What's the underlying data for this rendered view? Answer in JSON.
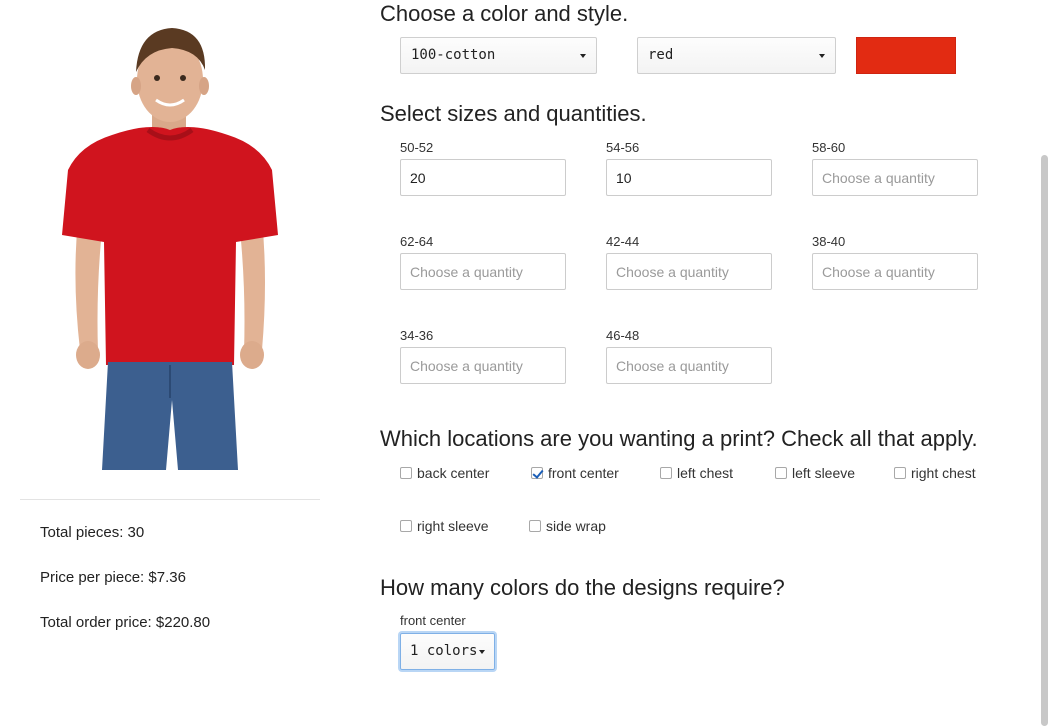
{
  "product": {
    "image_icon": "man-wearing-red-tshirt-photo",
    "shirt_color": "#d0141e"
  },
  "summary": {
    "total_pieces": "Total pieces: 30",
    "price_per_piece": "Price per piece: $7.36",
    "total_order_price": "Total order price: $220.80"
  },
  "color_style": {
    "title": "Choose a color and style.",
    "style_value": "100-cotton",
    "color_value": "red",
    "swatch_color": "#e22b12"
  },
  "sizes": {
    "title": "Select sizes and quantities.",
    "placeholder": "Choose a quantity",
    "items": [
      {
        "label": "50-52",
        "value": "20"
      },
      {
        "label": "54-56",
        "value": "10"
      },
      {
        "label": "58-60",
        "value": ""
      },
      {
        "label": "62-64",
        "value": ""
      },
      {
        "label": "42-44",
        "value": ""
      },
      {
        "label": "38-40",
        "value": ""
      },
      {
        "label": "34-36",
        "value": ""
      },
      {
        "label": "46-48",
        "value": ""
      }
    ]
  },
  "locations": {
    "title": "Which locations are you wanting a print? Check all that apply.",
    "items": [
      {
        "label": "back center",
        "checked": false
      },
      {
        "label": "front center",
        "checked": true
      },
      {
        "label": "left chest",
        "checked": false
      },
      {
        "label": "left sleeve",
        "checked": false
      },
      {
        "label": "right chest",
        "checked": false
      },
      {
        "label": "right sleeve",
        "checked": false
      },
      {
        "label": "side wrap",
        "checked": false
      }
    ]
  },
  "design_colors": {
    "title": "How many colors do the designs require?",
    "location_label": "front center",
    "value": "1 colors"
  }
}
